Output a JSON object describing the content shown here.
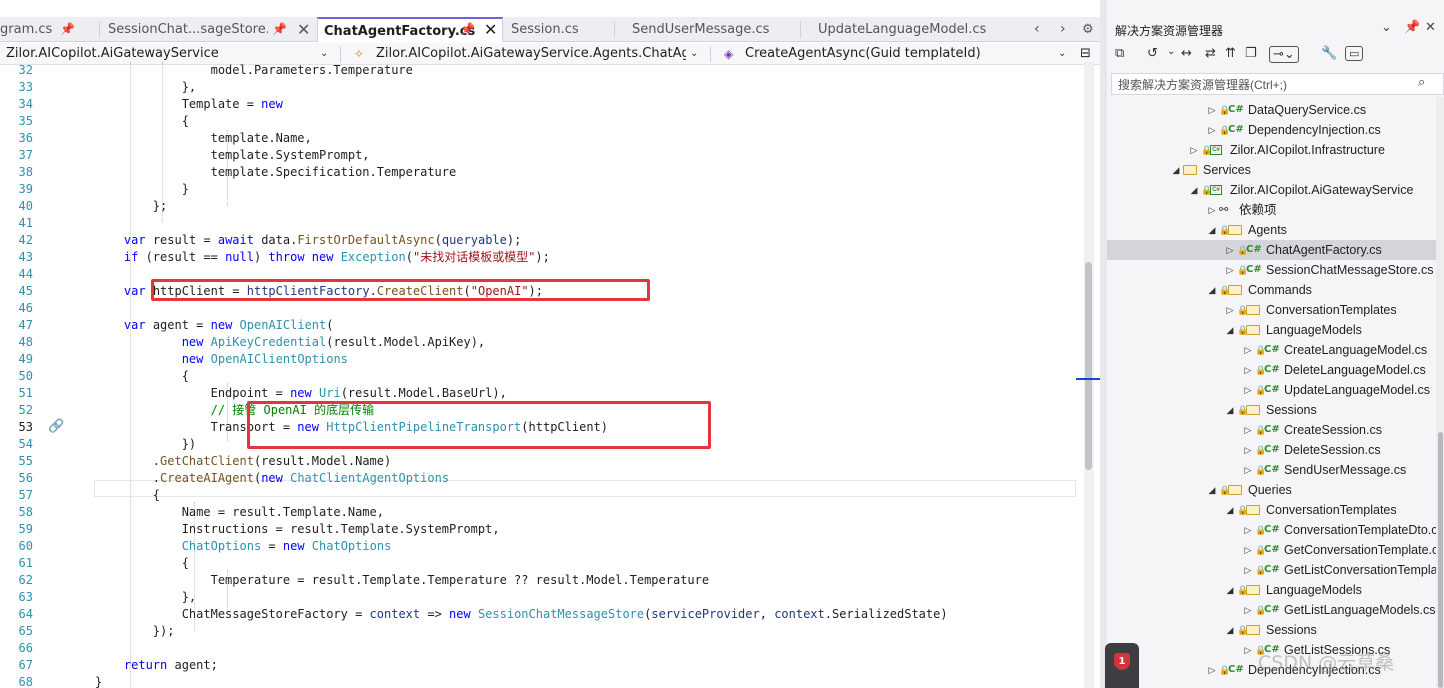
{
  "tabs": [
    {
      "label": "gram.cs",
      "pinned": true
    },
    {
      "label": "SessionChat...sageStore.cs",
      "pinned": true
    },
    {
      "label": "ChatAgentFactory.cs",
      "pinned": true,
      "active": true
    },
    {
      "label": "Session.cs"
    },
    {
      "label": "SendUserMessage.cs"
    },
    {
      "label": "UpdateLanguageModel.cs"
    }
  ],
  "navbar": {
    "project": "Zilor.AICopilot.AiGatewayService",
    "type": "Zilor.AICopilot.AiGatewayService.Agents.ChatAgentFa",
    "member": "CreateAgentAsync(Guid templateId)"
  },
  "code": {
    "current_line": 53,
    "lines": [
      {
        "n": "32",
        "t": "                model.Parameters.Temperature"
      },
      {
        "n": "33",
        "t": "            },"
      },
      {
        "n": "34",
        "t": "            Template = new"
      },
      {
        "n": "35",
        "t": "            {"
      },
      {
        "n": "36",
        "t": "                template.Name,"
      },
      {
        "n": "37",
        "t": "                template.SystemPrompt,"
      },
      {
        "n": "38",
        "t": "                template.Specification.Temperature"
      },
      {
        "n": "39",
        "t": "            }"
      },
      {
        "n": "40",
        "t": "        };"
      },
      {
        "n": "41",
        "t": ""
      },
      {
        "n": "42",
        "t": "    var result = await data.FirstOrDefaultAsync(queryable);"
      },
      {
        "n": "43",
        "t": "    if (result == null) throw new Exception(\"未找对话模板或模型\");"
      },
      {
        "n": "44",
        "t": ""
      },
      {
        "n": "45",
        "t": "    var httpClient = httpClientFactory.CreateClient(\"OpenAI\");"
      },
      {
        "n": "46",
        "t": ""
      },
      {
        "n": "47",
        "t": "    var agent = new OpenAIClient("
      },
      {
        "n": "48",
        "t": "            new ApiKeyCredential(result.Model.ApiKey),"
      },
      {
        "n": "49",
        "t": "            new OpenAIClientOptions"
      },
      {
        "n": "50",
        "t": "            {"
      },
      {
        "n": "51",
        "t": "                Endpoint = new Uri(result.Model.BaseUrl),"
      },
      {
        "n": "52",
        "t": "                // 接管 OpenAI 的底层传输"
      },
      {
        "n": "53",
        "t": "                Transport = new HttpClientPipelineTransport(httpClient)"
      },
      {
        "n": "54",
        "t": "            })"
      },
      {
        "n": "55",
        "t": "        .GetChatClient(result.Model.Name)"
      },
      {
        "n": "56",
        "t": "        .CreateAIAgent(new ChatClientAgentOptions"
      },
      {
        "n": "57",
        "t": "        {"
      },
      {
        "n": "58",
        "t": "            Name = result.Template.Name,"
      },
      {
        "n": "59",
        "t": "            Instructions = result.Template.SystemPrompt,"
      },
      {
        "n": "60",
        "t": "            ChatOptions = new ChatOptions"
      },
      {
        "n": "61",
        "t": "            {"
      },
      {
        "n": "62",
        "t": "                Temperature = result.Template.Temperature ?? result.Model.Temperature"
      },
      {
        "n": "63",
        "t": "            },"
      },
      {
        "n": "64",
        "t": "            ChatMessageStoreFactory = context => new SessionChatMessageStore(serviceProvider, context.SerializedState)"
      },
      {
        "n": "65",
        "t": "        });"
      },
      {
        "n": "66",
        "t": ""
      },
      {
        "n": "67",
        "t": "    return agent;"
      },
      {
        "n": "68",
        "t": "}"
      }
    ]
  },
  "solution_explorer": {
    "title": "解决方案资源管理器",
    "search_placeholder": "搜索解决方案资源管理器(Ctrl+;)",
    "tree": [
      {
        "label": "DataQueryService.cs",
        "kind": "cs",
        "depth": 2,
        "exp": "closed",
        "lock": true
      },
      {
        "label": "DependencyInjection.cs",
        "kind": "cs",
        "depth": 2,
        "exp": "closed",
        "lock": true
      },
      {
        "label": "Zilor.AICopilot.Infrastructure",
        "kind": "project",
        "depth": 1,
        "exp": "closed",
        "lock": true
      },
      {
        "label": "Services",
        "kind": "folder",
        "depth": 0,
        "exp": "open"
      },
      {
        "label": "Zilor.AICopilot.AiGatewayService",
        "kind": "project",
        "depth": 1,
        "exp": "open",
        "lock": true
      },
      {
        "label": "依赖项",
        "kind": "deps",
        "depth": 2,
        "exp": "closed"
      },
      {
        "label": "Agents",
        "kind": "folder",
        "depth": 2,
        "exp": "open",
        "lock": true
      },
      {
        "label": "ChatAgentFactory.cs",
        "kind": "cs",
        "depth": 3,
        "exp": "closed",
        "lock": true,
        "selected": true
      },
      {
        "label": "SessionChatMessageStore.cs",
        "kind": "cs",
        "depth": 3,
        "exp": "closed",
        "lock": true
      },
      {
        "label": "Commands",
        "kind": "folder",
        "depth": 2,
        "exp": "open",
        "lock": true
      },
      {
        "label": "ConversationTemplates",
        "kind": "folder",
        "depth": 3,
        "exp": "closed",
        "lock": true
      },
      {
        "label": "LanguageModels",
        "kind": "folder",
        "depth": 3,
        "exp": "open",
        "lock": true
      },
      {
        "label": "CreateLanguageModel.cs",
        "kind": "cs",
        "depth": 4,
        "exp": "closed",
        "lock": true
      },
      {
        "label": "DeleteLanguageModel.cs",
        "kind": "cs",
        "depth": 4,
        "exp": "closed",
        "lock": true
      },
      {
        "label": "UpdateLanguageModel.cs",
        "kind": "cs",
        "depth": 4,
        "exp": "closed",
        "lock": true
      },
      {
        "label": "Sessions",
        "kind": "folder",
        "depth": 3,
        "exp": "open",
        "lock": true
      },
      {
        "label": "CreateSession.cs",
        "kind": "cs",
        "depth": 4,
        "exp": "closed",
        "lock": true
      },
      {
        "label": "DeleteSession.cs",
        "kind": "cs",
        "depth": 4,
        "exp": "closed",
        "lock": true
      },
      {
        "label": "SendUserMessage.cs",
        "kind": "cs",
        "depth": 4,
        "exp": "closed",
        "lock": true
      },
      {
        "label": "Queries",
        "kind": "folder",
        "depth": 2,
        "exp": "open",
        "lock": true
      },
      {
        "label": "ConversationTemplates",
        "kind": "folder",
        "depth": 3,
        "exp": "open",
        "lock": true
      },
      {
        "label": "ConversationTemplateDto.cs",
        "kind": "cs",
        "depth": 4,
        "exp": "closed",
        "lock": true
      },
      {
        "label": "GetConversationTemplate.cs",
        "kind": "cs",
        "depth": 4,
        "exp": "closed",
        "lock": true
      },
      {
        "label": "GetListConversationTemplates.cs",
        "kind": "cs",
        "depth": 4,
        "exp": "closed",
        "lock": true
      },
      {
        "label": "LanguageModels",
        "kind": "folder",
        "depth": 3,
        "exp": "open",
        "lock": true
      },
      {
        "label": "GetListLanguageModels.cs",
        "kind": "cs",
        "depth": 4,
        "exp": "closed",
        "lock": true
      },
      {
        "label": "Sessions",
        "kind": "folder",
        "depth": 3,
        "exp": "open",
        "lock": true
      },
      {
        "label": "GetListSessions.cs",
        "kind": "cs",
        "depth": 4,
        "exp": "closed",
        "lock": true
      },
      {
        "label": "DependencyInjection.cs",
        "kind": "cs",
        "depth": 2,
        "exp": "closed",
        "lock": true
      }
    ]
  },
  "notification": {
    "count": "1"
  },
  "watermark": "CSDN @云草桑",
  "colors": {
    "highlight_box": "#e3353b",
    "keyword": "#0000ff",
    "type": "#2b91af",
    "string": "#a31515",
    "comment": "#008000",
    "accent_tab": "#6c63d6"
  },
  "icons": {
    "pin": "pin-icon",
    "close": "close-icon",
    "chevron": "chevron-down-icon",
    "search": "search-icon",
    "csharp": "csharp-file-icon",
    "folder": "folder-icon",
    "project": "csharp-project-icon",
    "lock": "lock-icon",
    "gear": "gear-icon"
  }
}
